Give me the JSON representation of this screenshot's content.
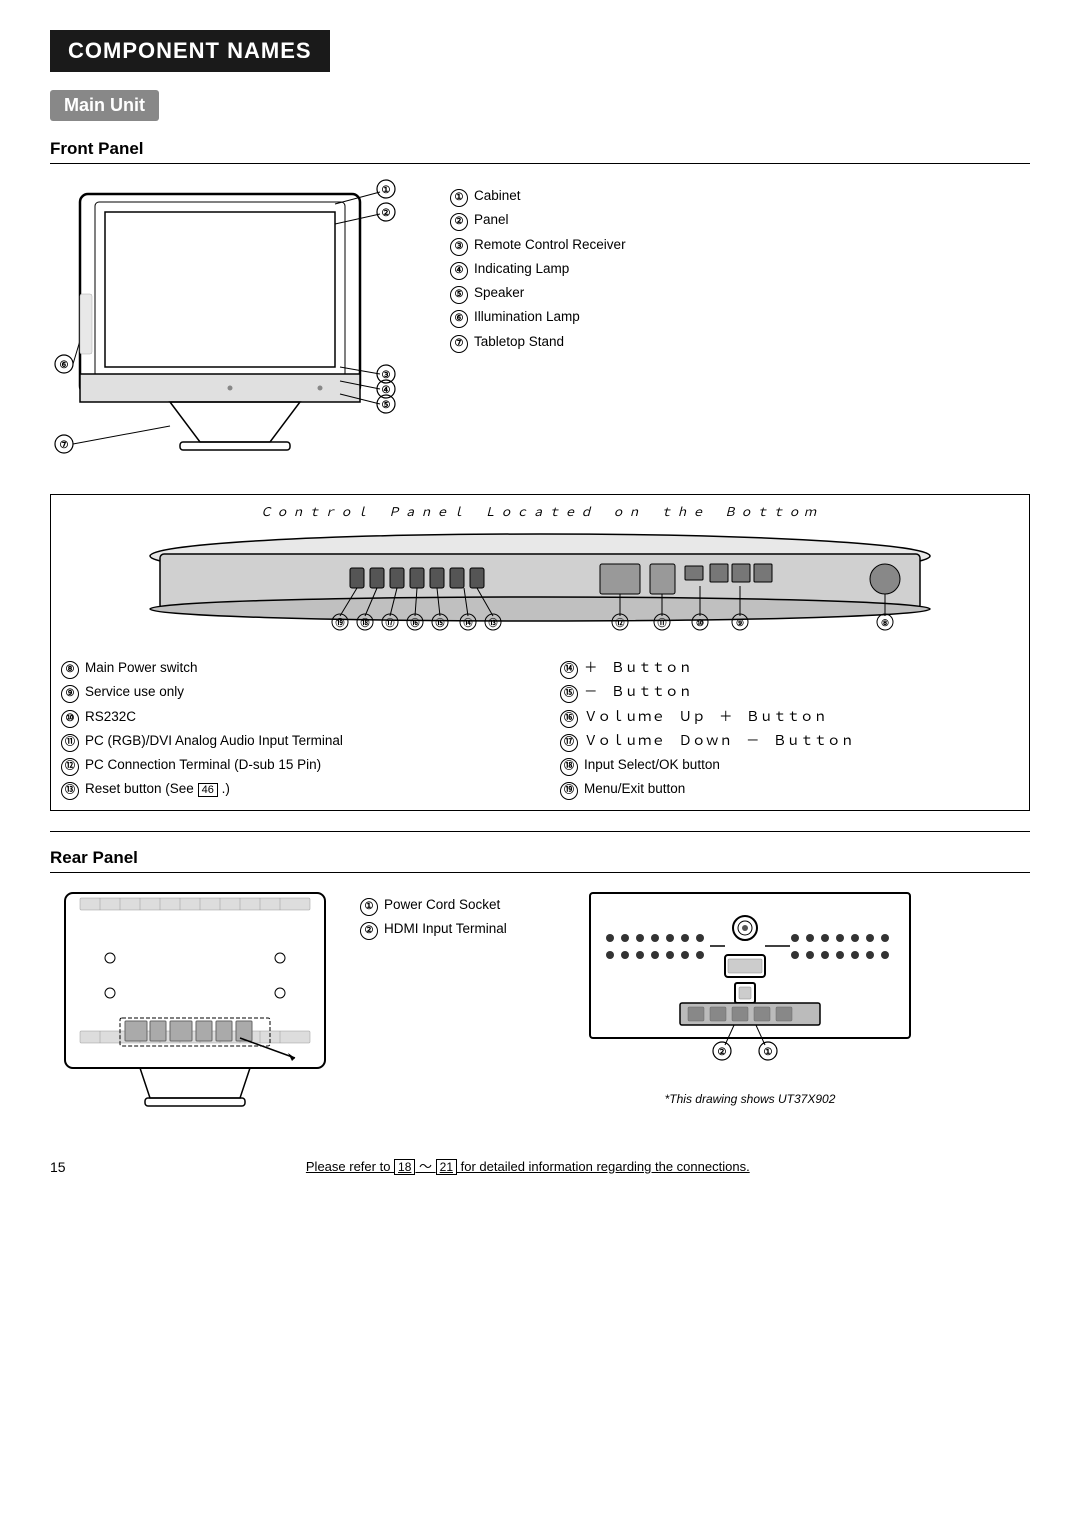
{
  "header": {
    "title": "COMPONENT NAMES",
    "subtitle": "Main Unit"
  },
  "front_panel": {
    "title": "Front Panel",
    "labels": [
      {
        "num": "①",
        "text": "Cabinet"
      },
      {
        "num": "②",
        "text": "Panel"
      },
      {
        "num": "③",
        "text": "Remote Control Receiver"
      },
      {
        "num": "④",
        "text": "Indicating Lamp"
      },
      {
        "num": "⑤",
        "text": "Speaker"
      },
      {
        "num": "⑥",
        "text": "Illumination Lamp"
      },
      {
        "num": "⑦",
        "text": "Tabletop Stand"
      }
    ]
  },
  "bottom_panel": {
    "title": "Ｃｏｎｔｒｏｌ　Ｐａｎｅｌ　Ｌｏｃａｔｅｄ　ｏｎ　ｔｈｅ　Ｂｏｔｔｏｍ",
    "labels_left": [
      {
        "num": "⑧",
        "text": "Main Power switch"
      },
      {
        "num": "⑨",
        "text": "Service use only"
      },
      {
        "num": "⑩",
        "text": "RS232C"
      },
      {
        "num": "⑪",
        "text": "PC (RGB)/DVI Analog Audio Input Terminal"
      },
      {
        "num": "⑫",
        "text": "PC Connection Terminal (D-sub 15 Pin)"
      },
      {
        "num": "⑬",
        "text": "Reset button (See 46 .)"
      }
    ],
    "labels_right": [
      {
        "num": "⑭",
        "text": "＋　Ｂｕｔｔｏｎ"
      },
      {
        "num": "⑮",
        "text": "－　Ｂｕｔｔｏｎ"
      },
      {
        "num": "⑯",
        "text": "Ｖｏｌｕｍｅ　Ｕｐ　＋　Ｂｕｔｔｏｎ"
      },
      {
        "num": "⑰",
        "text": "Ｖｏｌｕｍｅ　Ｄｏｗｎ　－　Ｂｕｔｔｏｎ"
      },
      {
        "num": "⑱",
        "text": "Input Select/OK button"
      },
      {
        "num": "⑲",
        "text": "Menu/Exit button"
      }
    ]
  },
  "rear_panel": {
    "title": "Rear Panel",
    "labels": [
      {
        "num": "①",
        "text": "Power Cord Socket"
      },
      {
        "num": "②",
        "text": "HDMI Input Terminal"
      }
    ],
    "footnote": "*This drawing shows UT37X902"
  },
  "footer": {
    "page_number": "15",
    "link_text": "Please refer to  18  ～ 21  for detailed information regarding the connections."
  }
}
